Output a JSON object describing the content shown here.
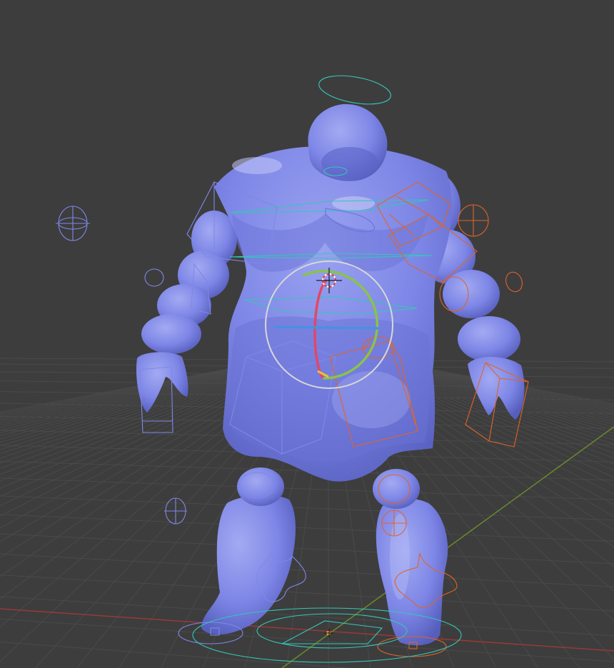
{
  "viewport": {
    "mode": "3d-viewport",
    "object": "character-mesh-with-armature-rig"
  },
  "colors": {
    "background": "#3d3d3d",
    "grid_line": "#4a4a4a",
    "x_axis": "#9a3838",
    "y_axis": "#6a8a2e",
    "mesh": "#7d86e6",
    "mesh_shadow": "#5a62c2",
    "mesh_highlight": "#b8bef5",
    "rig_left": "#7f88e8",
    "rig_right": "#e0642a",
    "rig_center": "#35c7b6",
    "rotate_gizmo_outer": "#d8d8d8",
    "rotate_gizmo_x": "#e04868",
    "rotate_gizmo_y": "#8ac24a",
    "rotate_gizmo_z": "#4a90e0",
    "cursor_3d": "#ffffff"
  },
  "icons": [
    "3d-cursor-icon",
    "origin-point-icon",
    "rotate-gizmo-icon"
  ]
}
